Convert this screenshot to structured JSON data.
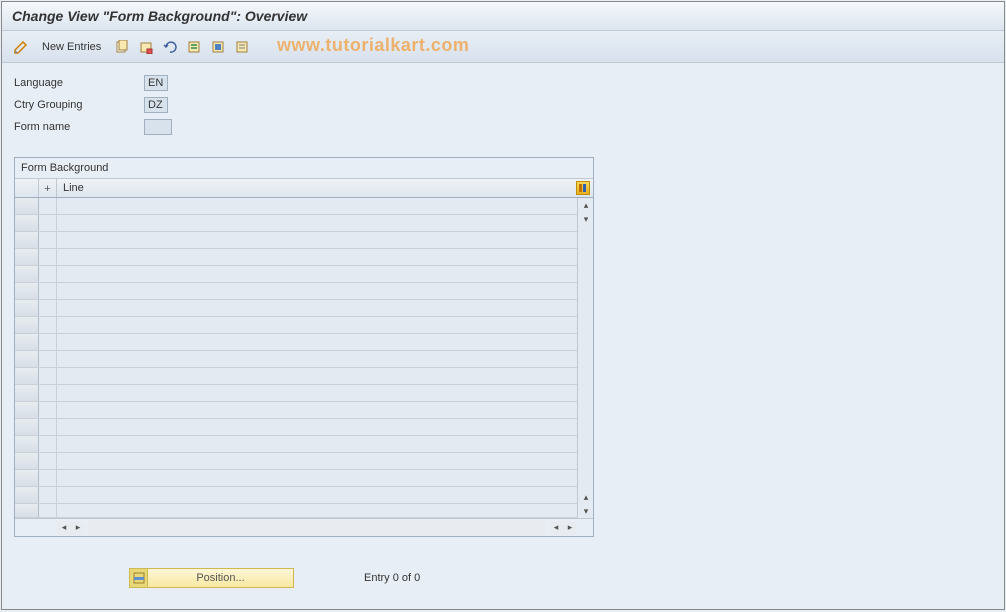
{
  "title": "Change View \"Form Background\": Overview",
  "toolbar": {
    "new_entries": "New Entries"
  },
  "watermark": "www.tutorialkart.com",
  "fields": {
    "language": {
      "label": "Language",
      "value": "EN"
    },
    "ctry_grouping": {
      "label": "Ctry Grouping",
      "value": "DZ"
    },
    "form_name": {
      "label": "Form name",
      "value": ""
    }
  },
  "table": {
    "title": "Form Background",
    "columns": {
      "plus": "+",
      "line": "Line"
    }
  },
  "bottom": {
    "position": "Position...",
    "entry": "Entry 0 of 0"
  }
}
